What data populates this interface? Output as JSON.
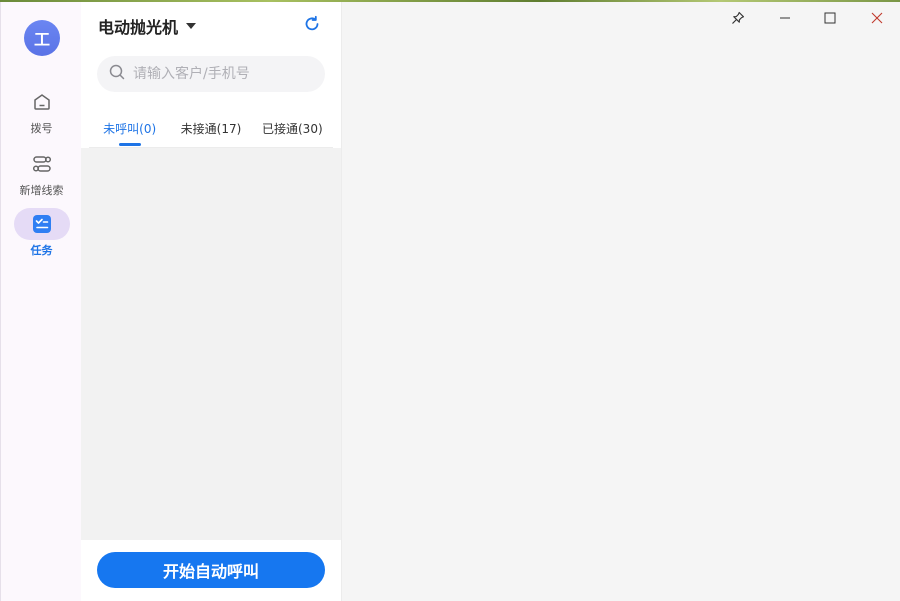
{
  "user": {
    "avatar_initial": "工"
  },
  "rail": {
    "items": [
      {
        "label": "拨号",
        "icon": "home-icon"
      },
      {
        "label": "新增线索",
        "icon": "workflow-icon"
      },
      {
        "label": "任务",
        "icon": "task-icon"
      }
    ],
    "active_index": 2
  },
  "panel": {
    "title": "电动抛光机",
    "search": {
      "placeholder": "请输入客户/手机号",
      "value": ""
    },
    "tabs": [
      {
        "label": "未呼叫(0)"
      },
      {
        "label": "未接通(17)"
      },
      {
        "label": "已接通(30)"
      }
    ],
    "active_tab": 0,
    "start_button": "开始自动呼叫"
  },
  "window_controls": [
    "pin-icon",
    "minimize-icon",
    "maximize-icon",
    "close-icon"
  ],
  "colors": {
    "accent": "#1e74e6",
    "button": "#1677f0",
    "avatar": "#6b86f2",
    "active_rail_bg": "#e5dbf6",
    "close": "#c0392b"
  }
}
